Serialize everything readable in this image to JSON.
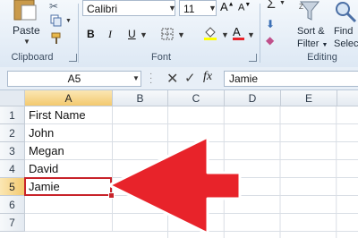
{
  "ribbon": {
    "clipboard": {
      "paste_label": "Paste",
      "group_label": "Clipboard"
    },
    "font": {
      "font_name": "Calibri",
      "font_size": "11",
      "group_label": "Font",
      "bold": "B",
      "italic": "I",
      "underline": "U",
      "grow_font": "A",
      "shrink_font": "A",
      "font_color_letter": "A"
    },
    "editing": {
      "sort_label": "Sort &",
      "filter_label": "Filter",
      "find_label": "Find",
      "select_label": "Selec",
      "group_label": "Editing"
    }
  },
  "formula_bar": {
    "name_box": "A5",
    "fx_label": "fx",
    "content": "Jamie"
  },
  "grid": {
    "columns": [
      "A",
      "B",
      "C",
      "D",
      "E"
    ],
    "rows": [
      {
        "num": "1",
        "a": "First Name"
      },
      {
        "num": "2",
        "a": "John"
      },
      {
        "num": "3",
        "a": "Megan"
      },
      {
        "num": "4",
        "a": "David"
      },
      {
        "num": "5",
        "a": "Jamie"
      },
      {
        "num": "6",
        "a": ""
      },
      {
        "num": "7",
        "a": ""
      }
    ],
    "selected_cell": "A5"
  },
  "colors": {
    "arrow": "#e8232a",
    "arrow_outline": "#ffffff",
    "selection_border": "#c8232a",
    "header_highlight": "#f3c96f"
  }
}
